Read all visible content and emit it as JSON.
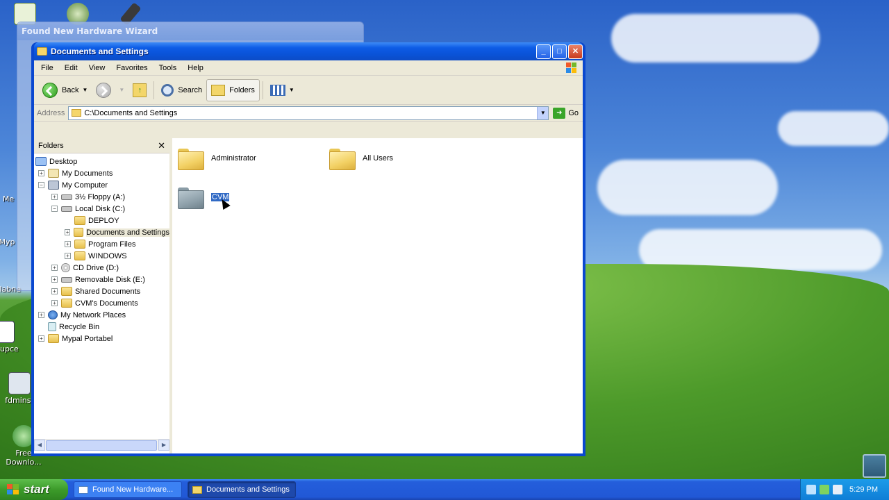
{
  "desktop": {
    "icons": [
      {
        "label": ""
      },
      {
        "label": "Collabne"
      },
      {
        "label": "setupce"
      },
      {
        "label": "fdminst"
      },
      {
        "label": "Free Downlo..."
      },
      {
        "label": "Myp"
      },
      {
        "label": "Me"
      }
    ]
  },
  "wizard": {
    "title": "Found New Hardware Wizard"
  },
  "explorer": {
    "title": "Documents and Settings",
    "menu": [
      "File",
      "Edit",
      "View",
      "Favorites",
      "Tools",
      "Help"
    ],
    "toolbar": {
      "back": "Back",
      "search": "Search",
      "folders": "Folders"
    },
    "address": {
      "label": "Address",
      "value": "C:\\Documents and Settings",
      "go": "Go"
    },
    "folders_pane": {
      "title": "Folders",
      "tree": [
        {
          "label": "Desktop"
        },
        {
          "label": "My Documents"
        },
        {
          "label": "My Computer"
        },
        {
          "label": "3½ Floppy (A:)"
        },
        {
          "label": "Local Disk (C:)"
        },
        {
          "label": "DEPLOY"
        },
        {
          "label": "Documents and Settings"
        },
        {
          "label": "Program Files"
        },
        {
          "label": "WINDOWS"
        },
        {
          "label": "CD Drive (D:)"
        },
        {
          "label": "Removable Disk (E:)"
        },
        {
          "label": "Shared Documents"
        },
        {
          "label": "CVM's Documents"
        },
        {
          "label": "My Network Places"
        },
        {
          "label": "Recycle Bin"
        },
        {
          "label": "Mypal Portabel"
        }
      ]
    },
    "items": [
      {
        "name": "Administrator"
      },
      {
        "name": "All Users"
      },
      {
        "name": "CVM"
      }
    ]
  },
  "taskbar": {
    "start": "start",
    "tasks": [
      {
        "label": "Found New Hardware..."
      },
      {
        "label": "Documents and Settings"
      }
    ],
    "clock": "5:29 PM"
  }
}
